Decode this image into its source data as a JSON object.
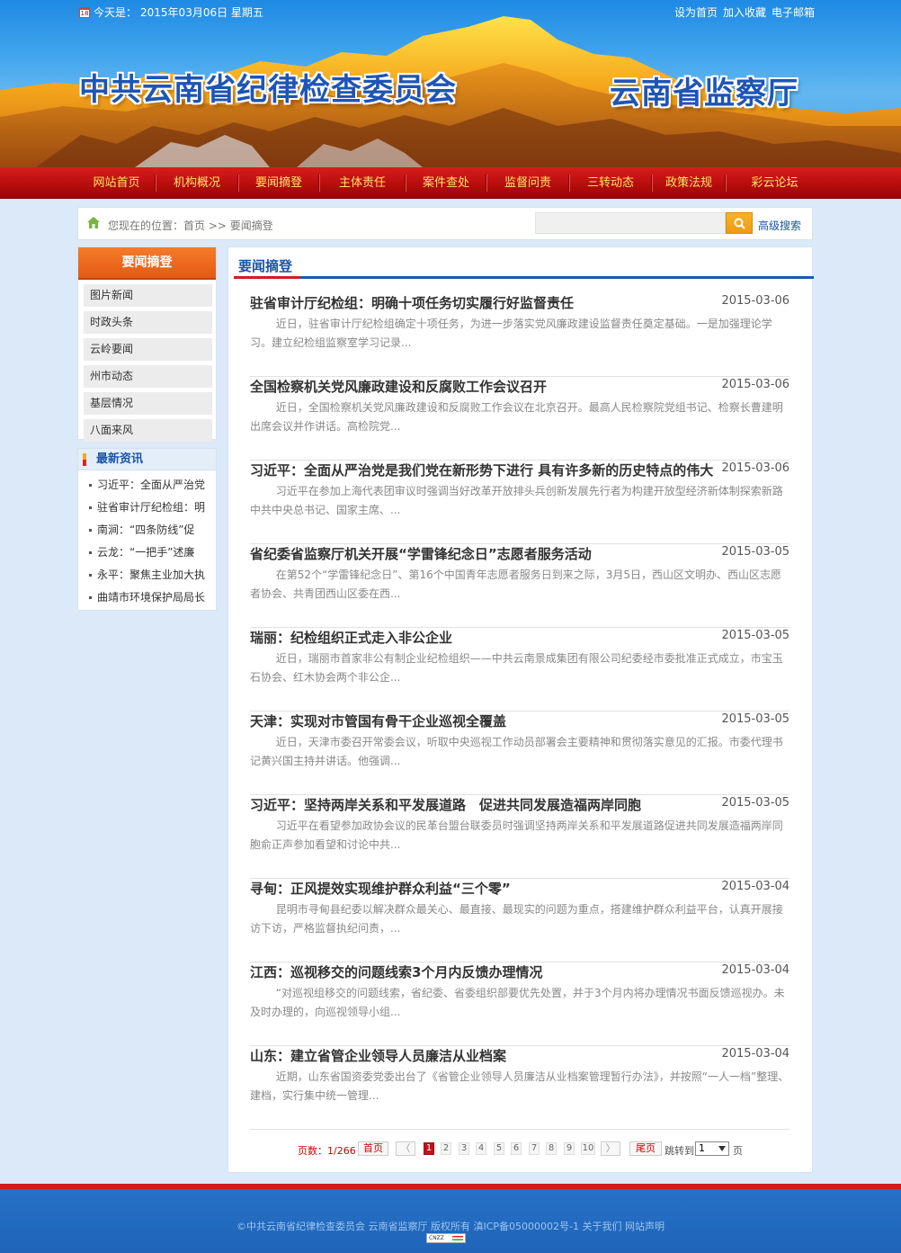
{
  "topbar": {
    "date_label": "今天是：",
    "date_value": "2015年03月06日 星期五",
    "links": [
      "设为首页",
      "加入收藏",
      "电子邮箱"
    ]
  },
  "logo": {
    "left": "中共云南省纪律检查委员会",
    "right": "云南省监察厅"
  },
  "nav": {
    "items": [
      "网站首页",
      "机构概况",
      "要闻摘登",
      "主体责任",
      "案件查处",
      "监督问责",
      "三转动态",
      "政策法规",
      "彩云论坛"
    ]
  },
  "breadcrumb": {
    "text": "您现在的位置：首页 >> 要闻摘登",
    "search_placeholder": "",
    "advanced_search": "高级搜索"
  },
  "sidebar": {
    "title": "要闻摘登",
    "items": [
      "图片新闻",
      "时政头条",
      "云岭要闻",
      "州市动态",
      "基层情况",
      "八面来风"
    ],
    "latest_title": "最新资讯",
    "latest": [
      "习近平：全面从严治党",
      "驻省审计厅纪检组：明",
      "南涧：“四条防线”促",
      "云龙：“一把手”述廉",
      "永平：聚焦主业加大执",
      "曲靖市环境保护局局长"
    ]
  },
  "main": {
    "title": "要闻摘登",
    "articles": [
      {
        "title": "驻省审计厅纪检组：明确十项任务切实履行好监督责任",
        "date": "2015-03-06",
        "summary": "近日，驻省审计厅纪检组确定十项任务，为进一步落实党风廉政建设监督责任奠定基础。一是加强理论学习。建立纪检组监察室学习记录..."
      },
      {
        "title": "全国检察机关党风廉政建设和反腐败工作会议召开",
        "date": "2015-03-06",
        "summary": "近日，全国检察机关党风廉政建设和反腐败工作会议在北京召开。最高人民检察院党组书记、检察长曹建明出席会议并作讲话。高检院党..."
      },
      {
        "title": "习近平：全面从严治党是我们党在新形势下进行 具有许多新的历史特点的伟大",
        "date": "2015-03-06",
        "summary": "习近平在参加上海代表团审议时强调当好改革开放排头兵创新发展先行者为构建开放型经济新体制探索新路中共中央总书记、国家主席、..."
      },
      {
        "title": "省纪委省监察厅机关开展“学雷锋纪念日”志愿者服务活动",
        "date": "2015-03-05",
        "summary": "在第52个“学雷锋纪念日”、第16个中国青年志愿者服务日到来之际，3月5日，西山区文明办、西山区志愿者协会、共青团西山区委在西..."
      },
      {
        "title": "瑞丽：纪检组织正式走入非公企业",
        "date": "2015-03-05",
        "summary": "近日，瑞丽市首家非公有制企业纪检组织——中共云南景成集团有限公司纪委经市委批准正式成立，市宝玉石协会、红木协会两个非公企..."
      },
      {
        "title": "天津：实现对市管国有骨干企业巡视全覆盖",
        "date": "2015-03-05",
        "summary": "近日，天津市委召开常委会议，听取中央巡视工作动员部署会主要精神和贯彻落实意见的汇报。市委代理书记黄兴国主持并讲话。他强调..."
      },
      {
        "title": "习近平：坚持两岸关系和平发展道路　促进共同发展造福两岸同胞",
        "date": "2015-03-05",
        "summary": "习近平在看望参加政协会议的民革台盟台联委员时强调坚持两岸关系和平发展道路促进共同发展造福两岸同胞俞正声参加看望和讨论中共..."
      },
      {
        "title": "寻甸：正风提效实现维护群众利益“三个零”",
        "date": "2015-03-04",
        "summary": "昆明市寻甸县纪委以解决群众最关心、最直接、最现实的问题为重点，搭建维护群众利益平台，认真开展接访下访，严格监督执纪问责，..."
      },
      {
        "title": "江西：巡视移交的问题线索3个月内反馈办理情况",
        "date": "2015-03-04",
        "summary": "“对巡视组移交的问题线索，省纪委、省委组织部要优先处置，并于3个月内将办理情况书面反馈巡视办。未及时办理的，向巡视领导小组..."
      },
      {
        "title": "山东：建立省管企业领导人员廉洁从业档案",
        "date": "2015-03-04",
        "summary": "近期，山东省国资委党委出台了《省管企业领导人员廉洁从业档案管理暂行办法》，并按照“一人一档”整理、建档，实行集中统一管理..."
      }
    ]
  },
  "pager": {
    "info": "页数：1/266",
    "first": "首页",
    "prev": "〈",
    "pages": [
      "1",
      "2",
      "3",
      "4",
      "5",
      "6",
      "7",
      "8",
      "9",
      "10"
    ],
    "current": "1",
    "next": "〉",
    "last": "尾页",
    "jump_label": "跳转到",
    "jump_value": "1",
    "page_suffix": "页"
  },
  "footer": {
    "text": "©中共云南省纪律检查委员会 云南省监察厅 版权所有 滇ICP备05000002号-1 关于我们 网站声明",
    "badge": "CNZZ"
  },
  "colors": {
    "nav_red": "#b40c0c",
    "nav_text": "#ffe566",
    "accent_blue": "#1b54a5",
    "side_orange": "#e45a14"
  },
  "icons": [
    "calendar-icon",
    "home-icon",
    "search-icon"
  ]
}
